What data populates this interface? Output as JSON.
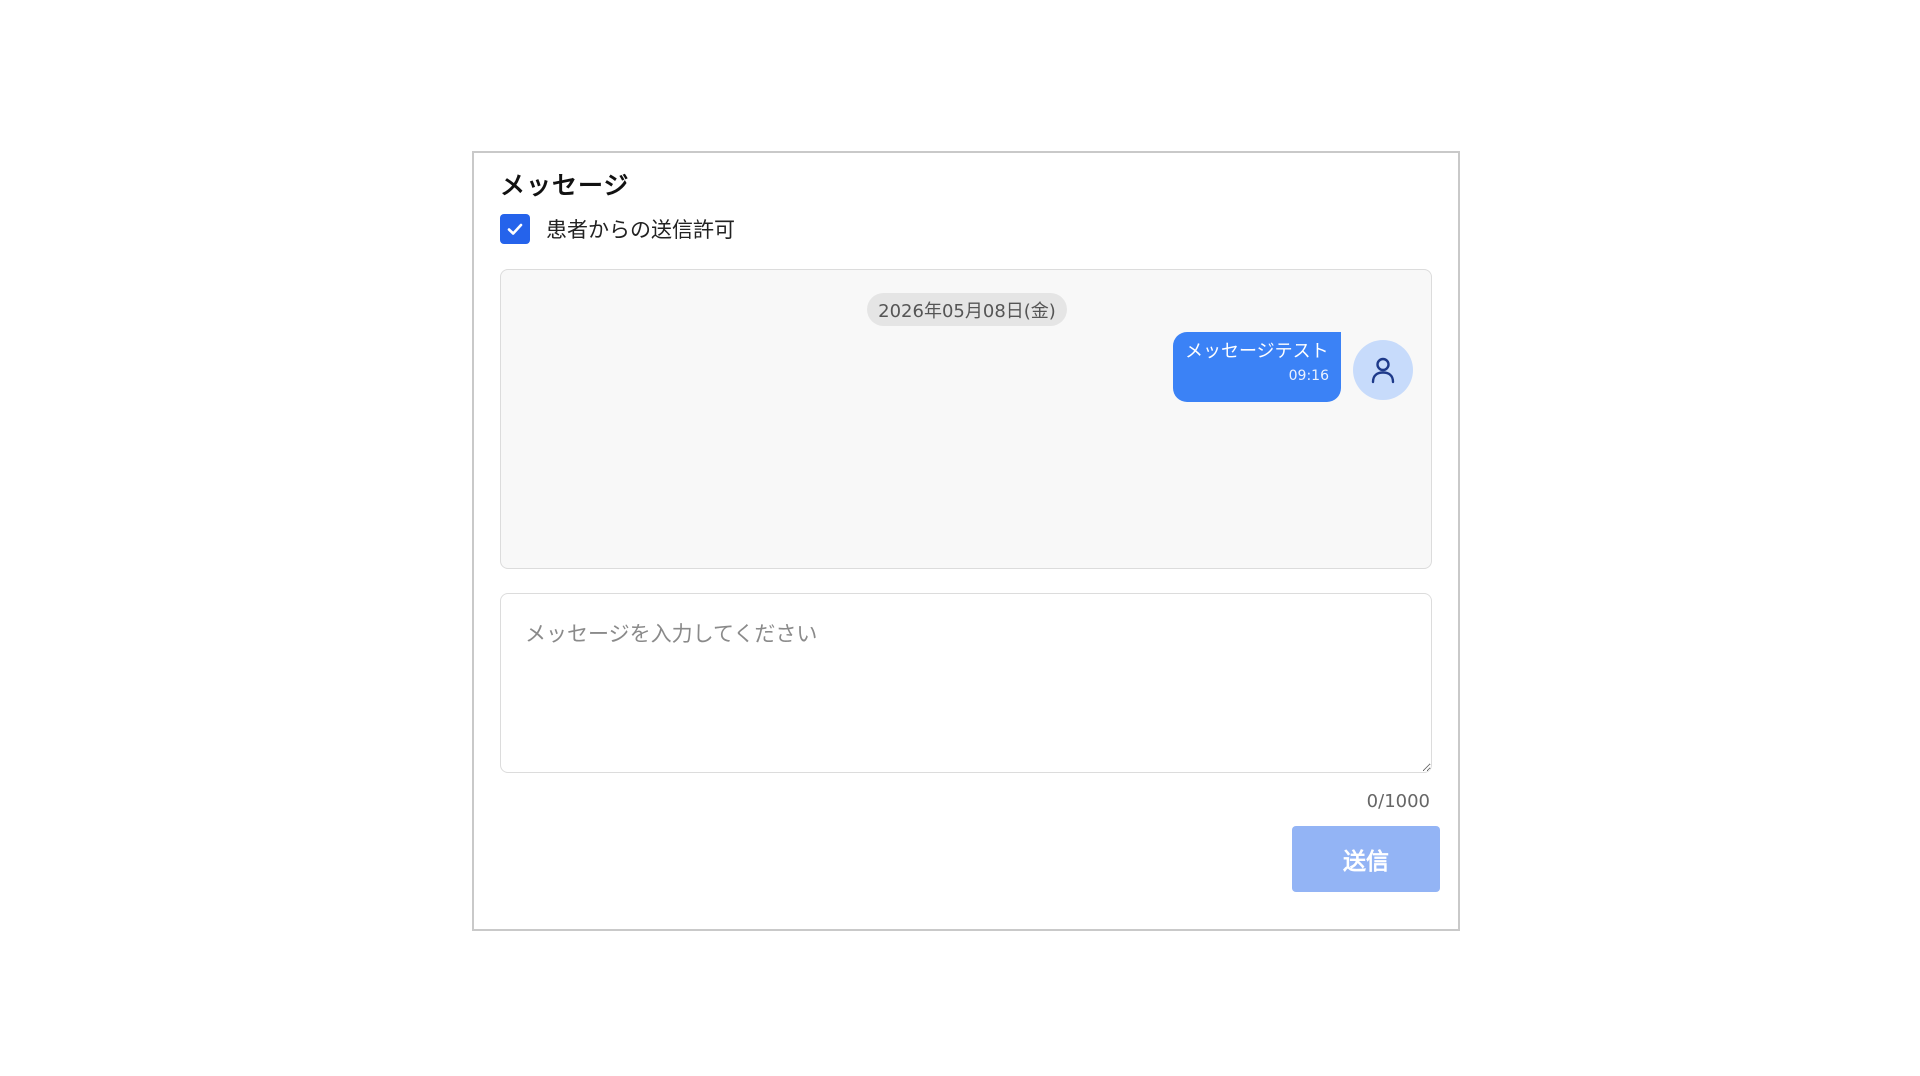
{
  "messages_panel": {
    "title": "メッセージ",
    "permission_checkbox": {
      "label": "患者からの送信許可",
      "checked": true,
      "color": "#2563eb"
    },
    "chat": {
      "date_separator": "2026年05月08日(金)",
      "messages": [
        {
          "text": "メッセージテスト",
          "time": "09:16",
          "sender": "self",
          "bubble_color": "#3b82f6",
          "avatar_icon": "user-icon"
        }
      ]
    },
    "composer": {
      "placeholder": "メッセージを入力してください",
      "value": "",
      "char_count": "0/1000"
    },
    "send_button": {
      "label": "送信",
      "enabled": false,
      "color": "#93b4f5"
    }
  }
}
